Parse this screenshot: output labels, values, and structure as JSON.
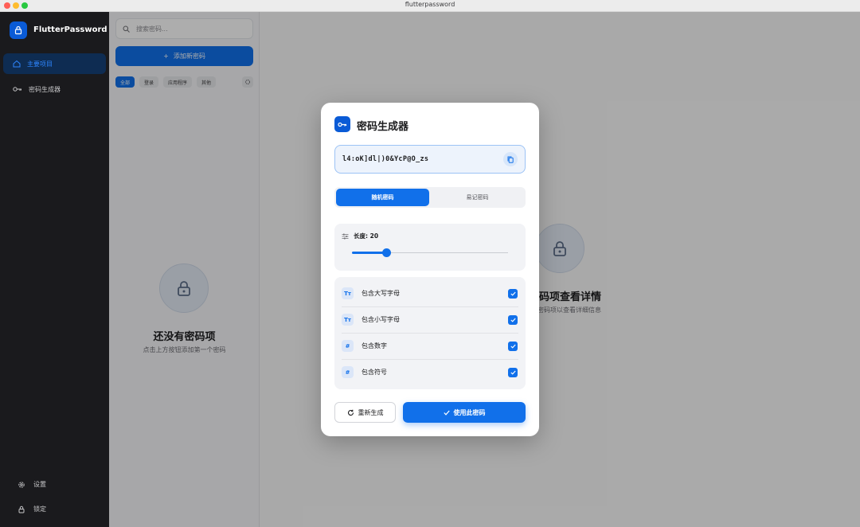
{
  "window": {
    "title": "flutterpassword"
  },
  "sidebar": {
    "app_name": "FlutterPassword",
    "items": [
      {
        "label": "主要项目",
        "icon": "home-icon",
        "active": true
      },
      {
        "label": "密码生成器",
        "icon": "key-icon",
        "active": false
      }
    ],
    "bottom": [
      {
        "label": "设置",
        "icon": "gear-icon"
      },
      {
        "label": "锁定",
        "icon": "lock-icon"
      }
    ]
  },
  "list": {
    "search_placeholder": "搜索密码...",
    "add_label": "添加新密码",
    "chips": [
      "全部",
      "登录",
      "应用程序",
      "其他"
    ],
    "empty_title": "还没有密码项",
    "empty_sub": "点击上方按钮添加第一个密码"
  },
  "detail": {
    "title": "个密码项查看详情",
    "sub": "择一个密码项以查看详细信息"
  },
  "dialog": {
    "title": "密码生成器",
    "password": "l4:oK]dl|)0&YcP@O_zs",
    "tabs": [
      "随机密码",
      "易记密码"
    ],
    "length_label": "长度: 20",
    "length_value": 20,
    "length_fraction": 0.22,
    "options": [
      {
        "icon_text": "Tт",
        "label": "包含大写字母",
        "checked": true
      },
      {
        "icon_text": "Tт",
        "label": "包含小写字母",
        "checked": true
      },
      {
        "icon_text": "#",
        "label": "包含数字",
        "checked": true
      },
      {
        "icon_text": "#",
        "label": "包含符号",
        "checked": true
      }
    ],
    "regenerate_label": "重新生成",
    "use_label": "使用此密码"
  },
  "colors": {
    "accent": "#1170ea",
    "sidebar_bg": "#1a1a1d"
  }
}
